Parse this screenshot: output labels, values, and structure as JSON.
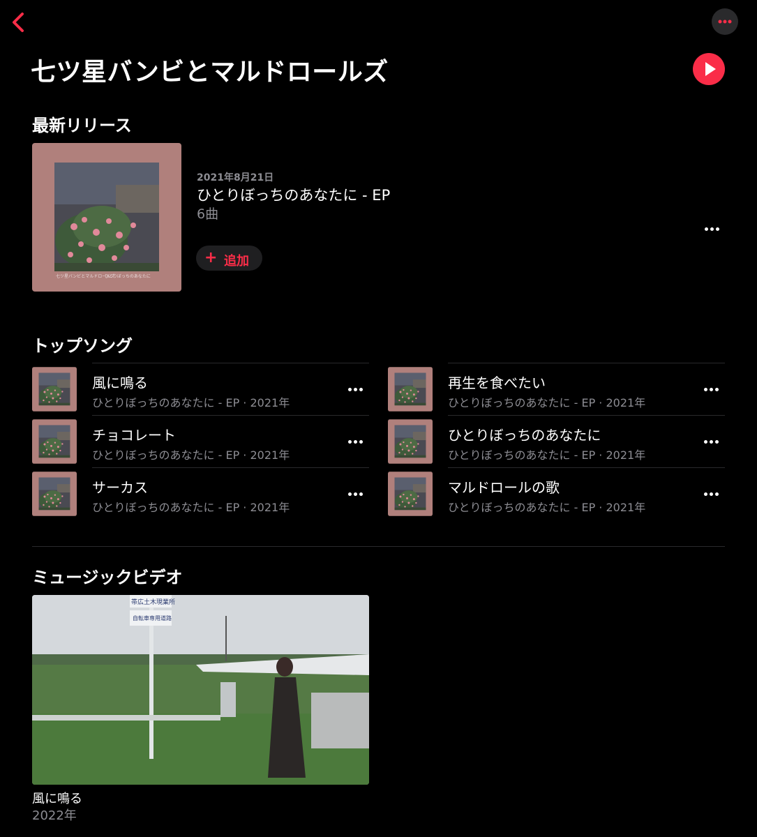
{
  "colors": {
    "accent": "#fa2d48",
    "background": "#000000",
    "secondary_text": "#8d8d93"
  },
  "nav": {
    "back_icon": "chevron-left-icon",
    "more_icon": "ellipsis-icon"
  },
  "artist": {
    "name": "七ツ星バンビとマルドロールズ",
    "play_icon": "play-icon"
  },
  "latest_release": {
    "section_title": "最新リリース",
    "date": "2021年8月21日",
    "title": "ひとりぼっちのあなたに - EP",
    "track_count": "6曲",
    "add_label": "追加",
    "art_caption_left": "七ツ星バンビとマルドロールズ",
    "art_caption_right": "ひとりぼっちのあなたに"
  },
  "top_songs": {
    "section_title": "トップソング",
    "items": [
      {
        "title": "風に鳴る",
        "subtitle": "ひとりぼっちのあなたに - EP · 2021年"
      },
      {
        "title": "チョコレート",
        "subtitle": "ひとりぼっちのあなたに - EP · 2021年"
      },
      {
        "title": "サーカス",
        "subtitle": "ひとりぼっちのあなたに - EP · 2021年"
      },
      {
        "title": "再生を食べたい",
        "subtitle": "ひとりぼっちのあなたに - EP · 2021年"
      },
      {
        "title": "ひとりぼっちのあなたに",
        "subtitle": "ひとりぼっちのあなたに - EP · 2021年"
      },
      {
        "title": "マルドロールの歌",
        "subtitle": "ひとりぼっちのあなたに - EP · 2021年"
      }
    ]
  },
  "music_videos": {
    "section_title": "ミュージックビデオ",
    "items": [
      {
        "title": "風に鳴る",
        "year": "2022年",
        "sign_top": "帯広土木現業所",
        "sign_bottom": "自転車専用道路"
      }
    ]
  }
}
